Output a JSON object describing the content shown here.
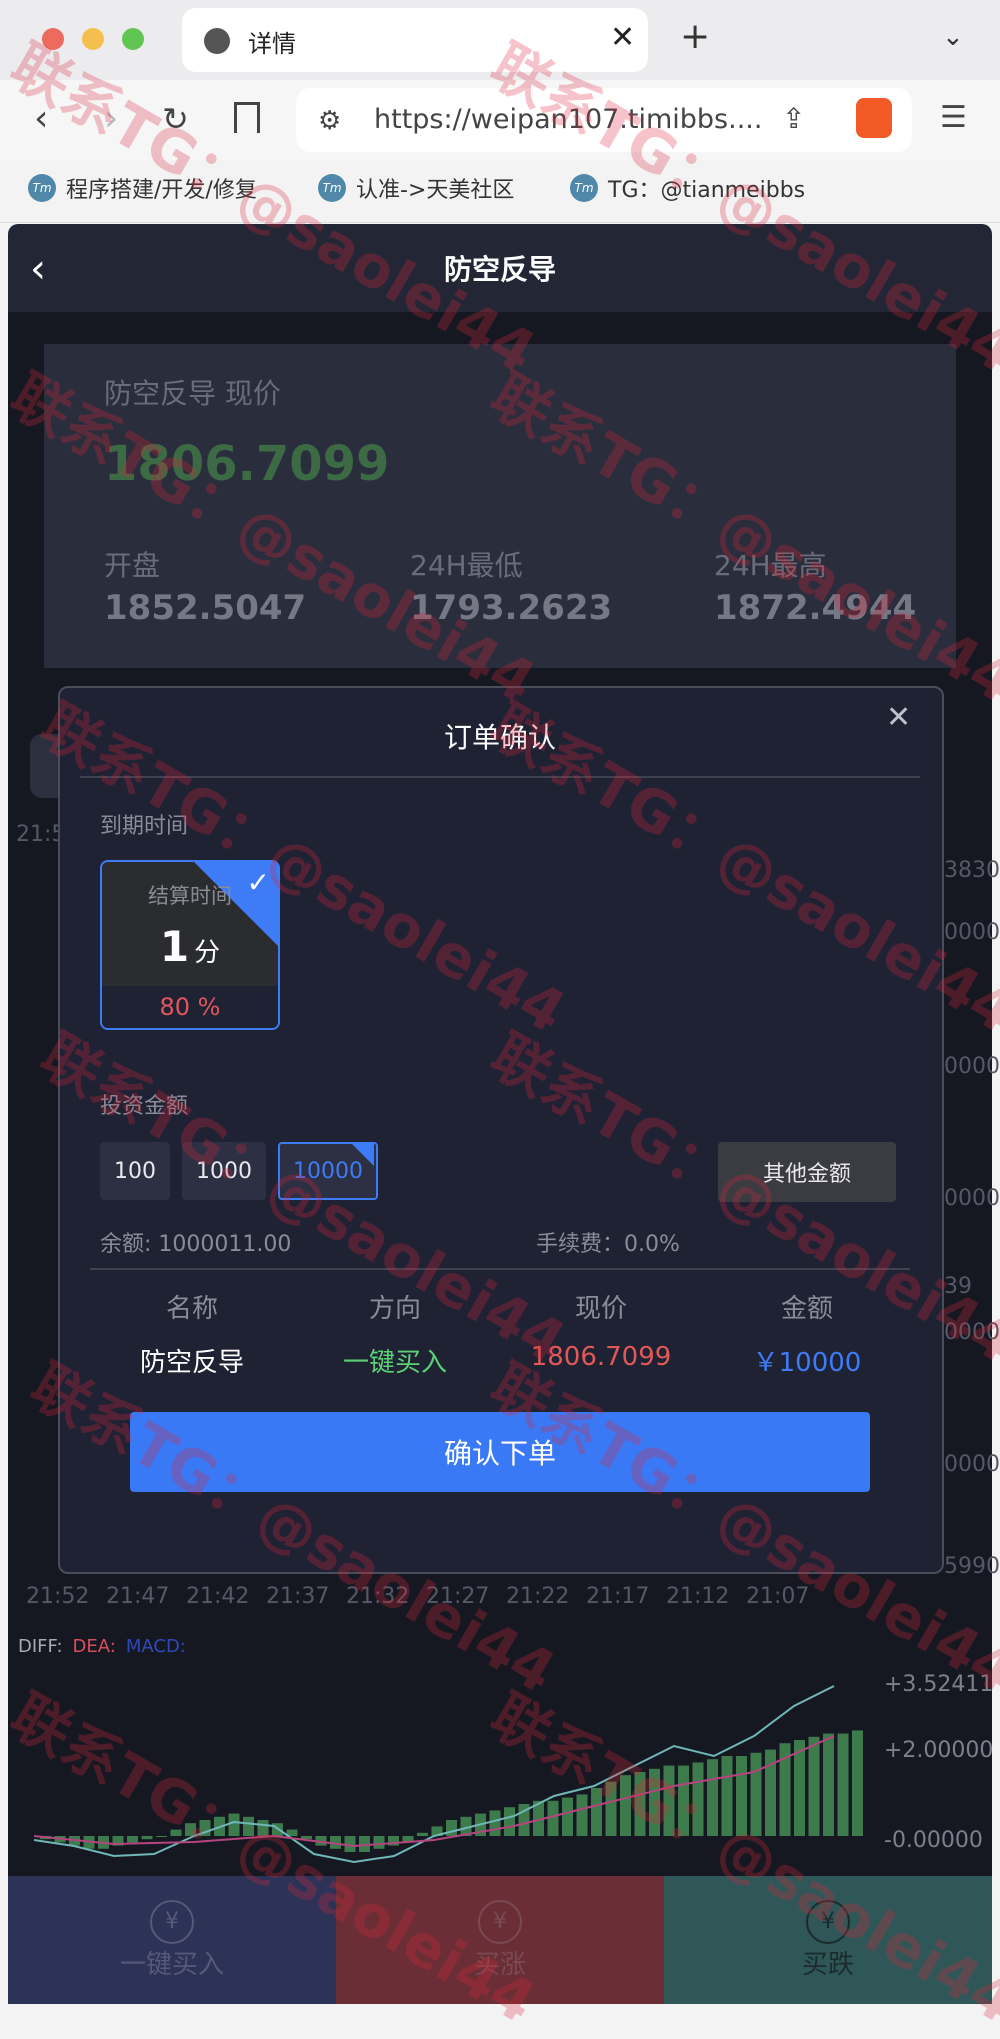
{
  "browser": {
    "tab_title": "详情",
    "url": "https://weipan107.timibbs....",
    "bookmarks": [
      {
        "icon": "Tm",
        "label": "程序搭建/开发/修复"
      },
      {
        "icon": "Tm",
        "label": "认准->天美社区"
      },
      {
        "icon": "Tm",
        "label": "TG：@tianmeibbs"
      }
    ]
  },
  "header": {
    "title": "防空反导"
  },
  "quote": {
    "label": "防空反导 现价",
    "price": "1806.7099",
    "open_label": "开盘",
    "open": "1852.5047",
    "low_label": "24H最低",
    "low": "1793.2623",
    "high_label": "24H最高",
    "high": "1872.4944"
  },
  "chart": {
    "left_time": "21:5",
    "right_prices": [
      "3830",
      "0000",
      "0000",
      "0000",
      "39",
      "0000",
      "0000",
      "5990"
    ],
    "x_times": [
      "21:52",
      "21:47",
      "21:42",
      "21:37",
      "21:32",
      "21:27",
      "21:22",
      "21:17",
      "21:12",
      "21:07"
    ],
    "macd_legend": {
      "diff": "DIFF:",
      "dea": "DEA:",
      "macd": "MACD:"
    },
    "macd_axis": [
      "+3.52411",
      "+2.00000",
      "-0.00000"
    ]
  },
  "modal": {
    "title": "订单确认",
    "expire_label": "到期时间",
    "period": {
      "caption": "结算时间",
      "value": "1",
      "unit": "分",
      "rate": "80 %"
    },
    "amount_label": "投资金额",
    "amounts": [
      "100",
      "1000",
      "10000"
    ],
    "selected_amount": "10000",
    "other_amount": "其他金额",
    "balance_label": "余额: ",
    "balance": "1000011.00",
    "fee_label": "手续费：",
    "fee": "0.0%",
    "table_headers": [
      "名称",
      "方向",
      "现价",
      "金额"
    ],
    "table_row": {
      "name": "防空反导",
      "direction": "一键买入",
      "price": "1806.7099",
      "amount": "￥10000"
    },
    "confirm": "确认下单"
  },
  "bottom": {
    "buy_one": "一键买入",
    "buy_up": "买涨",
    "buy_down": "买跌"
  },
  "watermark": "联系TG：@saolei44",
  "colors": {
    "accent": "#3a79f6",
    "up": "#5bd176",
    "down": "#e05858"
  }
}
